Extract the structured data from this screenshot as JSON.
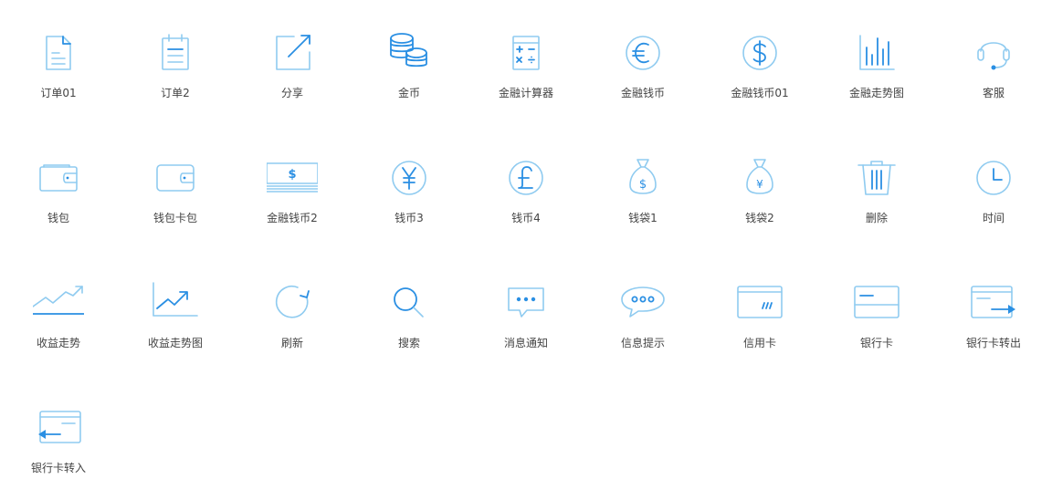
{
  "colors": {
    "accent": "#2a8fe3",
    "light": "#8fcbf0",
    "label": "#444444"
  },
  "icons": [
    {
      "label": "订单01",
      "icon": "order-document-icon"
    },
    {
      "label": "订单2",
      "icon": "order-notepad-icon"
    },
    {
      "label": "分享",
      "icon": "share-arrow-icon"
    },
    {
      "label": "金币",
      "icon": "coin-stack-icon"
    },
    {
      "label": "金融计算器",
      "icon": "calculator-icon"
    },
    {
      "label": "金融钱币",
      "icon": "euro-coin-icon"
    },
    {
      "label": "金融钱币01",
      "icon": "dollar-coin-icon"
    },
    {
      "label": "金融走势图",
      "icon": "bar-chart-icon"
    },
    {
      "label": "客服",
      "icon": "headset-icon"
    },
    {
      "label": "钱包",
      "icon": "wallet-icon"
    },
    {
      "label": "钱包卡包",
      "icon": "wallet-card-icon"
    },
    {
      "label": "金融钱币2",
      "icon": "banknote-stack-icon"
    },
    {
      "label": "钱币3",
      "icon": "yen-coin-icon"
    },
    {
      "label": "钱币4",
      "icon": "pound-coin-icon"
    },
    {
      "label": "钱袋1",
      "icon": "dollar-money-bag-icon"
    },
    {
      "label": "钱袋2",
      "icon": "yen-money-bag-icon"
    },
    {
      "label": "删除",
      "icon": "trash-icon"
    },
    {
      "label": "时间",
      "icon": "clock-icon"
    },
    {
      "label": "收益走势",
      "icon": "trend-line-icon"
    },
    {
      "label": "收益走势图",
      "icon": "trend-chart-icon"
    },
    {
      "label": "刷新",
      "icon": "refresh-icon"
    },
    {
      "label": "搜索",
      "icon": "search-icon"
    },
    {
      "label": "消息通知",
      "icon": "message-bubble-icon"
    },
    {
      "label": "信息提示",
      "icon": "chat-bubble-icon"
    },
    {
      "label": "信用卡",
      "icon": "credit-card-icon"
    },
    {
      "label": "银行卡",
      "icon": "bank-card-icon"
    },
    {
      "label": "银行卡转出",
      "icon": "card-transfer-out-icon"
    },
    {
      "label": "银行卡转入",
      "icon": "card-transfer-in-icon"
    }
  ]
}
